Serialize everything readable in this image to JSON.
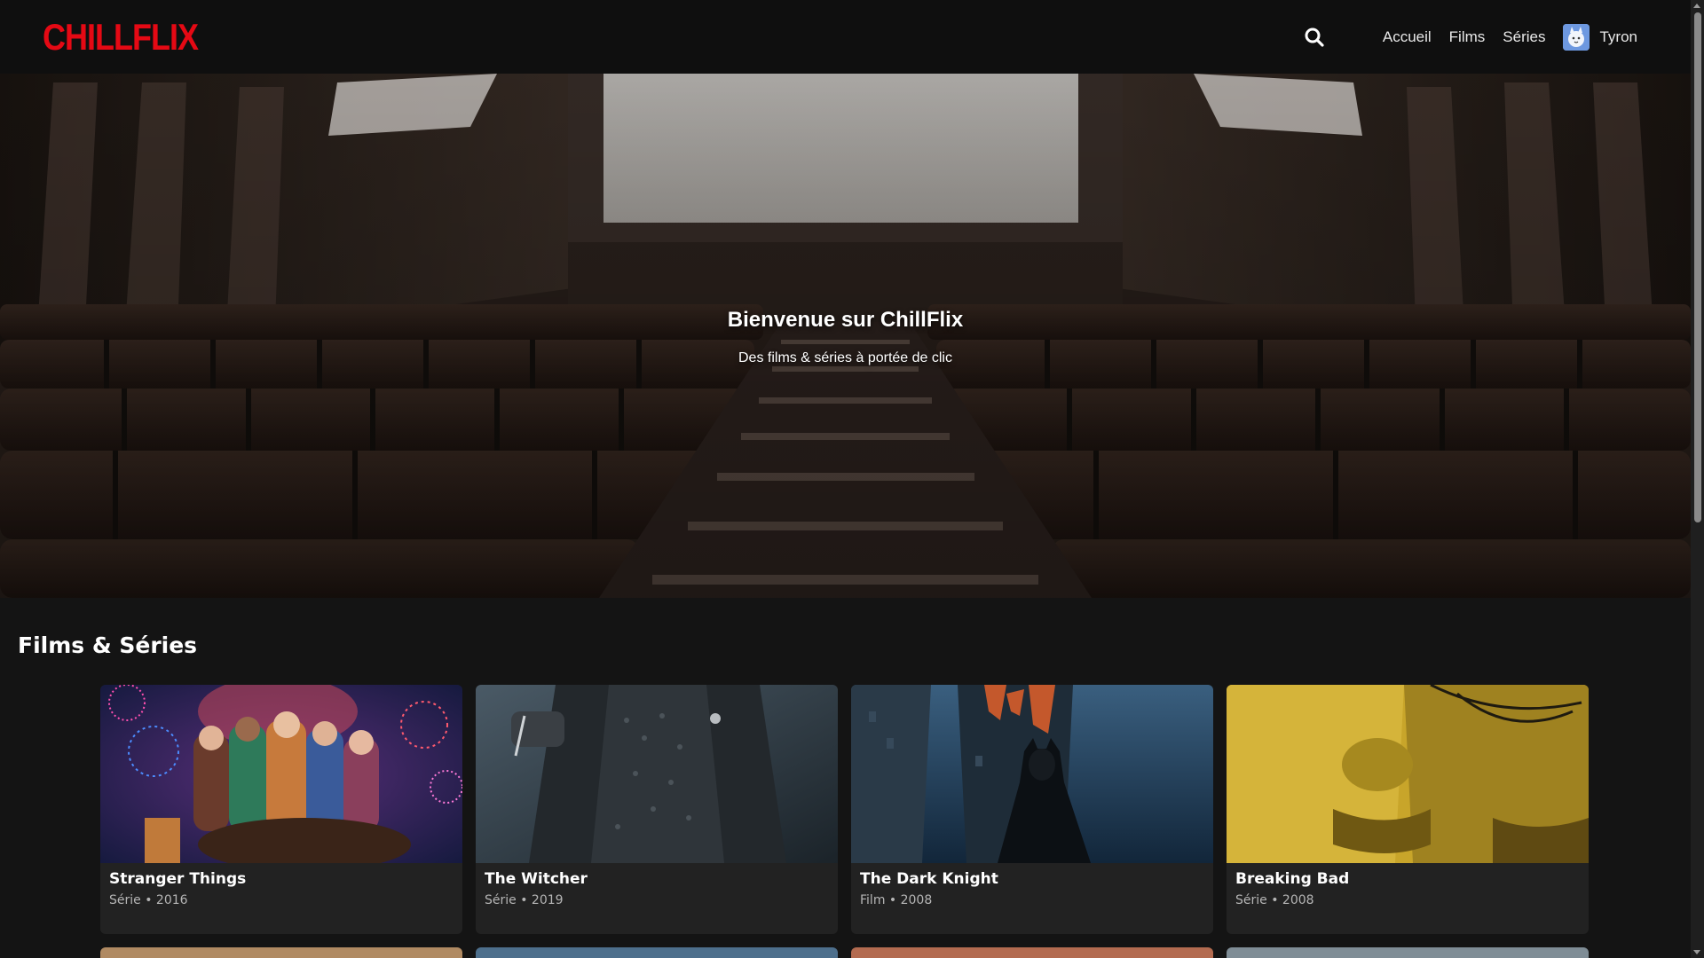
{
  "app": {
    "logo_text": "CHILLFLIX",
    "brand_color": "#e50914"
  },
  "nav": {
    "search_icon": "search-icon",
    "links": [
      "Accueil",
      "Films",
      "Séries"
    ],
    "user": {
      "name": "Tyron",
      "avatar_icon": "avatar-icon"
    }
  },
  "hero": {
    "title": "Bienvenue sur ChillFlix",
    "subtitle": "Des films & séries à portée de clic"
  },
  "section": {
    "title": "Films & Séries"
  },
  "items": [
    {
      "title": "Stranger Things",
      "meta": "Série • 2016"
    },
    {
      "title": "The Witcher",
      "meta": "Série • 2019"
    },
    {
      "title": "The Dark Knight",
      "meta": "Film • 2008"
    },
    {
      "title": "Breaking Bad",
      "meta": "Série • 2008"
    }
  ]
}
